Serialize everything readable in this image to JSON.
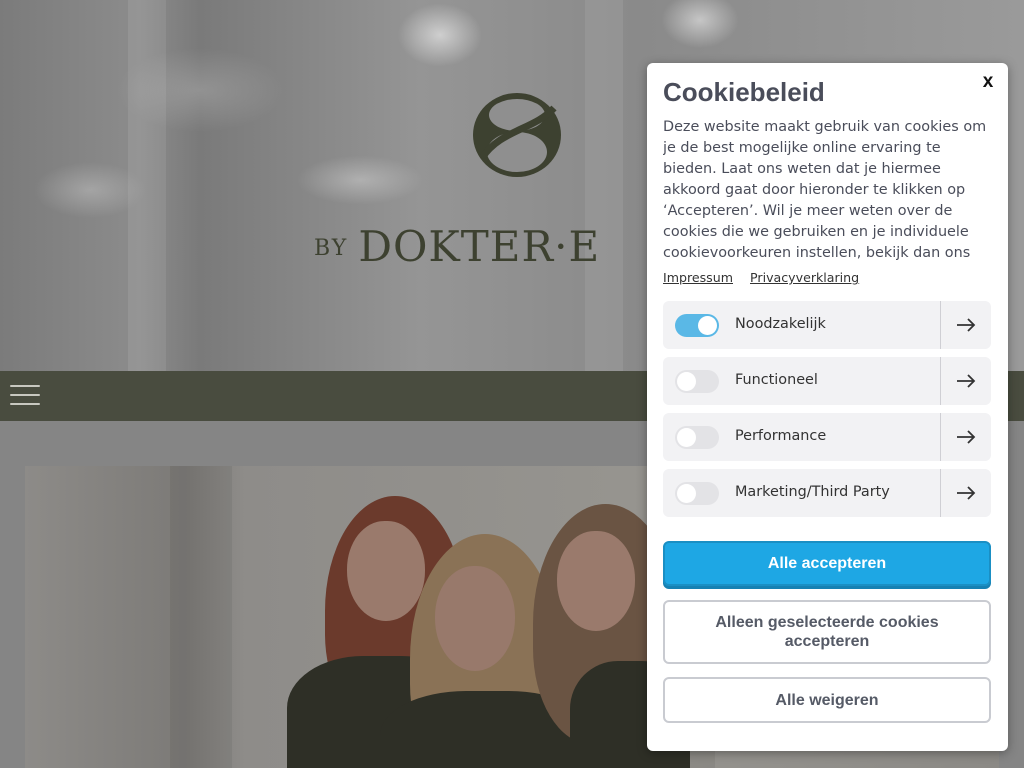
{
  "site": {
    "logo_by": "BY",
    "logo_name": "DOKTER·E",
    "menu_icon": "hamburger-icon"
  },
  "cookie_modal": {
    "title": "Cookiebeleid",
    "close_label": "x",
    "description": "Deze website maakt gebruik van cookies om je de best mogelijke online ervaring te bieden. Laat ons weten dat je hiermee akkoord gaat door hieronder te klikken op ‘Accepteren’. Wil je meer weten over de cookies die we gebruiken en je individuele cookievoorkeuren instellen, bekijk dan ons",
    "links": {
      "impressum": "Impressum",
      "privacy": "Privacyverklaring"
    },
    "categories": [
      {
        "label": "Noodzakelijk",
        "enabled": true
      },
      {
        "label": "Functioneel",
        "enabled": false
      },
      {
        "label": "Performance",
        "enabled": false
      },
      {
        "label": "Marketing/Third Party",
        "enabled": false
      }
    ],
    "buttons": {
      "accept_all": "Alle accepteren",
      "accept_selected": "Alleen geselecteerde cookies accepteren",
      "reject_all": "Alle weigeren"
    },
    "colors": {
      "primary": "#1ea7e4",
      "toggle_on": "#5ab8e6",
      "text": "#4a4d5a"
    }
  }
}
